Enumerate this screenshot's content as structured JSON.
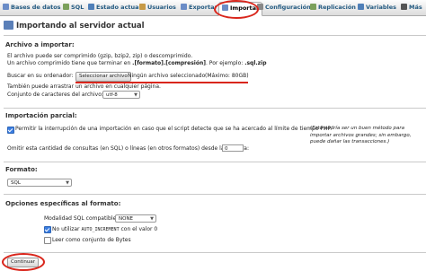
{
  "tabs": [
    {
      "label": "Bases de datos",
      "icon": "database-icon",
      "color": "#6a8cc7"
    },
    {
      "label": "SQL",
      "icon": "sql-icon",
      "color": "#7ba05b"
    },
    {
      "label": "Estado actual",
      "icon": "status-icon",
      "color": "#4f7fb8"
    },
    {
      "label": "Usuarios",
      "icon": "users-icon",
      "color": "#c79a46"
    },
    {
      "label": "Exportar",
      "icon": "export-icon",
      "color": "#6a8cc7"
    },
    {
      "label": "Importar",
      "icon": "import-icon",
      "color": "#6a8cc7",
      "active": true
    },
    {
      "label": "Configuración",
      "icon": "wrench-icon",
      "color": "#888888"
    },
    {
      "label": "Replicación",
      "icon": "replication-icon",
      "color": "#7ba05b"
    },
    {
      "label": "Variables",
      "icon": "variables-icon",
      "color": "#4f7fb8"
    },
    {
      "label": "Más",
      "icon": "chevron-down-icon",
      "color": "#555555"
    }
  ],
  "page": {
    "title": "Importando al servidor actual"
  },
  "archivo": {
    "heading": "Archivo a importar:",
    "line1": "El archivo puede ser comprimido (gzip, bzip2, zip) o descomprimido.",
    "line2_pre": "Un archivo comprimido tiene que terminar en ",
    "line2_fmt": ".[formato].[compresión]",
    "line2_mid": ". Por ejemplo: ",
    "line2_ex": ".sql.zip",
    "browse_label": "Buscar en su ordenador:",
    "choose_button": "Seleccionar archivo",
    "no_file": "Ningún archivo seleccionado",
    "max_size": "(Máximo: 80GB)",
    "drag_hint": "También puede arrastrar un archivo en cualquier página.",
    "charset_label": "Conjunto de caracteres del archivo:",
    "charset_value": "utf-8"
  },
  "parcial": {
    "heading": "Importación parcial:",
    "allow_interrupt": "Permitir la interrupción de una importación en caso que el script detecte que se ha acercado al límite de tiempo PHP.",
    "allow_interrupt_note": "(Esto podría ser un buen método para importar archivos grandes; sin embargo, puede dañar las transacciones.)",
    "skip_label": "Omitir esta cantidad de consultas (en SQL) o líneas (en otros formatos) desde la primera:",
    "skip_value": "0"
  },
  "formato": {
    "heading": "Formato:",
    "value": "SQL"
  },
  "opciones": {
    "heading": "Opciones específicas al formato:",
    "compat_label": "Modalidad SQL compatible:",
    "compat_value": "NONE",
    "auto_inc_pre": "No utilizar ",
    "auto_inc_code": "AUTO_INCREMENT",
    "auto_inc_post": " con el valor 0",
    "read_bytes": "Leer como conjunto de Bytes"
  },
  "submit": {
    "label": "Continuar"
  },
  "annotation_color": "#d9261c"
}
